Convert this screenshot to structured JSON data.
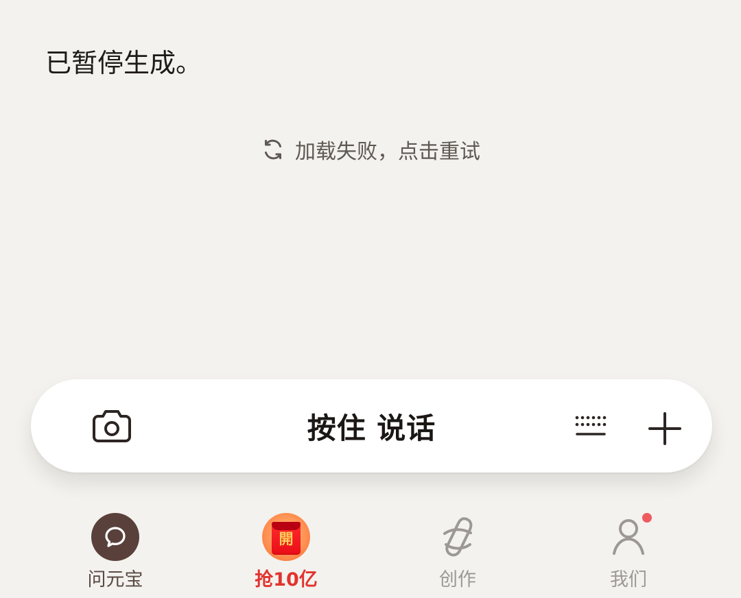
{
  "conversation": {
    "status_message": "已暂停生成。",
    "retry_text": "加载失败，点击重试"
  },
  "input_bar": {
    "voice_label": "按住 说话",
    "icons": {
      "camera": "camera-icon",
      "keyboard": "keyboard-icon",
      "plus": "plus-icon"
    }
  },
  "tabs": [
    {
      "label": "问元宝",
      "icon": "chat-bubble-icon",
      "color": "#5a4944",
      "active": true
    },
    {
      "label": "抢10亿",
      "icon": "red-envelope-icon",
      "icon_text": "開",
      "color": "#e2332f",
      "active": false
    },
    {
      "label": "创作",
      "icon": "creation-icon",
      "color": "#9d9895",
      "active": false
    },
    {
      "label": "我们",
      "icon": "profile-icon",
      "color": "#9d9895",
      "active": false,
      "notification": true,
      "notification_color": "#ef5a5f"
    }
  ],
  "colors": {
    "background": "#f3f2ee",
    "text": "#1e1a17",
    "muted_text": "#5f5853",
    "input_background": "#ffffff",
    "accent_red": "#e2332f"
  }
}
